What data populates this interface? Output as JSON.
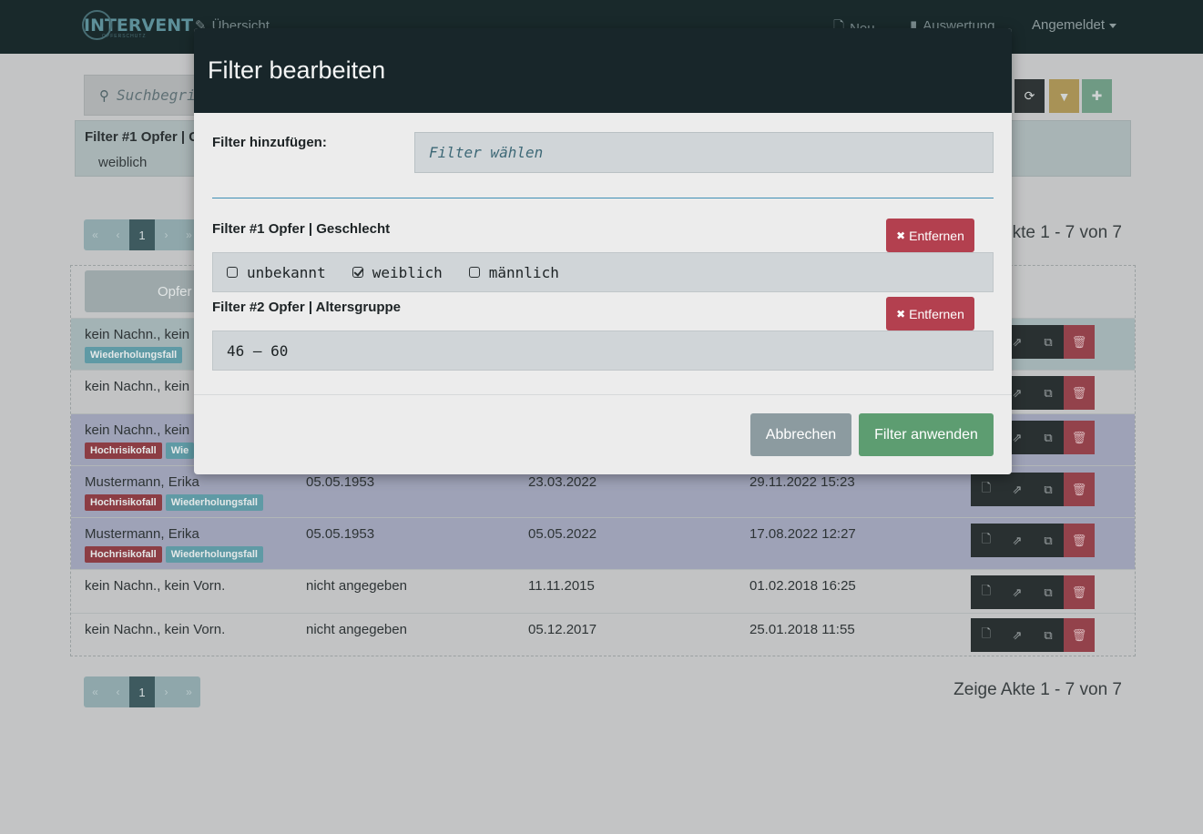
{
  "navbar": {
    "brand": "INTERVENT",
    "brand_sub": "OPFERSCHUTZ",
    "overview": "Übersicht",
    "new": "Neu",
    "evaluation": "Auswertung",
    "user": "Angemeldet"
  },
  "background": {
    "search_placeholder": "Suchbegriff",
    "filter_summary_title": "Filter #1 Opfer | G",
    "filter_summary_value": "weiblich",
    "pager_current": "1",
    "count_text": "Zeige Akte 1 - 7 von 7",
    "count_text_top": "kte 1 - 7 von 7",
    "column_header": "Opfer",
    "rows": [
      {
        "name": "kein Nachn., kein",
        "dob": "",
        "date": "",
        "modified": "",
        "badges": [
          "Wiederholungsfall"
        ]
      },
      {
        "name": "kein Nachn., kein",
        "dob": "",
        "date": "",
        "modified": "",
        "badges": []
      },
      {
        "name": "kein Nachn., kein",
        "dob": "",
        "date": "",
        "modified": "",
        "badges": [
          "Hochrisikofall",
          "Wie"
        ]
      },
      {
        "name": "Mustermann, Erika",
        "dob": "05.05.1953",
        "date": "23.03.2022",
        "modified": "29.11.2022 15:23",
        "badges": [
          "Hochrisikofall",
          "Wiederholungsfall"
        ]
      },
      {
        "name": "Mustermann, Erika",
        "dob": "05.05.1953",
        "date": "05.05.2022",
        "modified": "17.08.2022 12:27",
        "badges": [
          "Hochrisikofall",
          "Wiederholungsfall"
        ]
      },
      {
        "name": "kein Nachn., kein Vorn.",
        "dob": "nicht angegeben",
        "date": "11.11.2015",
        "modified": "01.02.2018 16:25",
        "badges": []
      },
      {
        "name": "kein Nachn., kein Vorn.",
        "dob": "nicht angegeben",
        "date": "05.12.2017",
        "modified": "25.01.2018 11:55",
        "badges": []
      }
    ]
  },
  "modal": {
    "title": "Filter bearbeiten",
    "add_filter_label": "Filter hinzufügen:",
    "add_filter_placeholder": "Filter wählen",
    "filters": [
      {
        "title": "Filter #1 Opfer | Geschlecht",
        "remove_label": "Entfernen",
        "options": [
          {
            "label": "unbekannt",
            "checked": false
          },
          {
            "label": "weiblich",
            "checked": true
          },
          {
            "label": "männlich",
            "checked": false
          }
        ]
      },
      {
        "title": "Filter #2 Opfer | Altersgruppe",
        "remove_label": "Entfernen",
        "value": "46 – 60"
      }
    ],
    "cancel_label": "Abbrechen",
    "apply_label": "Filter anwenden"
  }
}
